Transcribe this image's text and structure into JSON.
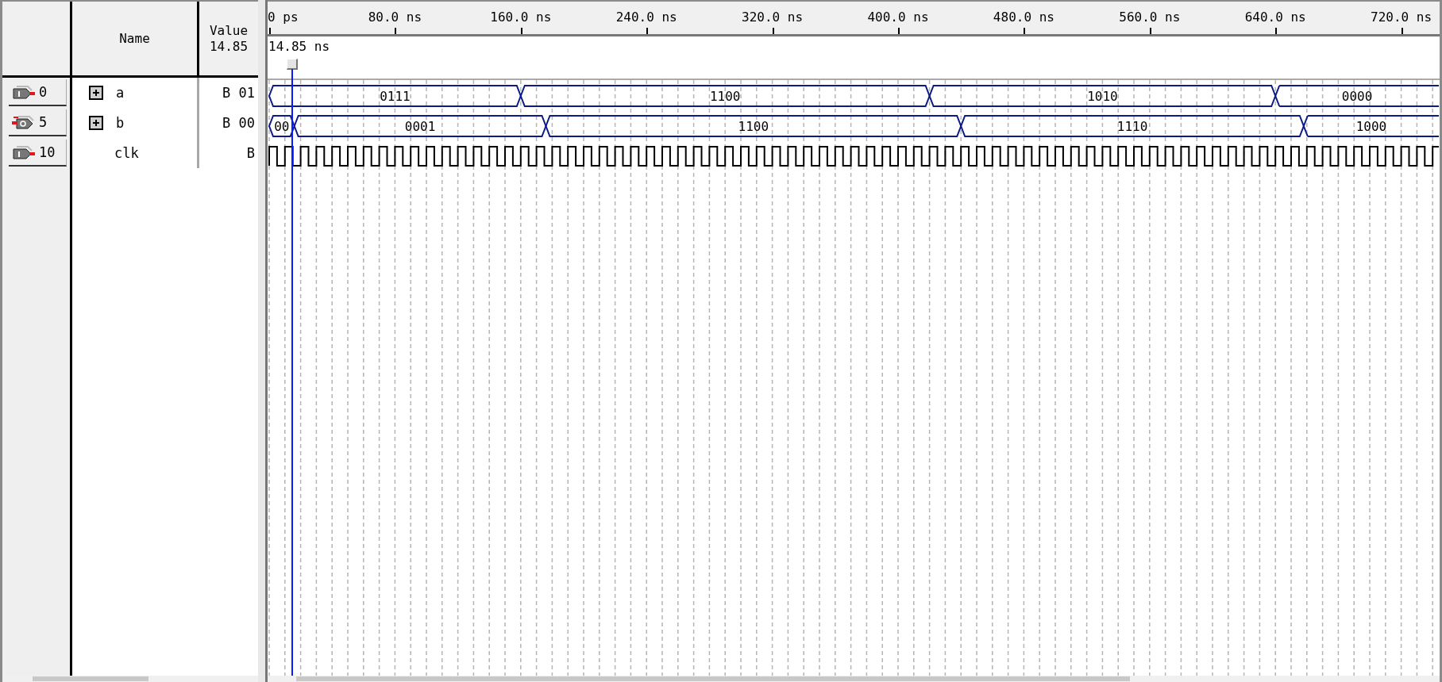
{
  "header": {
    "name": "Name",
    "value": "Value",
    "value_time": "14.85"
  },
  "ruler": {
    "ticks": [
      "0 ps",
      "80.0 ns",
      "160.0 ns",
      "240.0 ns",
      "320.0 ns",
      "400.0 ns",
      "480.0 ns",
      "560.0 ns",
      "640.0 ns",
      "720.0 ns"
    ]
  },
  "cursor": {
    "time": "14.85 ns"
  },
  "signals": [
    {
      "index": "0",
      "pin": {
        "kind": "input"
      },
      "name": "a",
      "expandable": true,
      "value": "B 01",
      "wave": {
        "kind": "bus",
        "segments": [
          "0111",
          "1100",
          "1010",
          "0000"
        ]
      }
    },
    {
      "index": "5",
      "pin": {
        "kind": "output"
      },
      "name": "b",
      "expandable": true,
      "value": "B 00",
      "wave": {
        "kind": "bus",
        "segments": [
          "00",
          "0001",
          "1100",
          "1110",
          "1000"
        ]
      }
    },
    {
      "index": "10",
      "pin": {
        "kind": "input"
      },
      "name": "clk",
      "expandable": false,
      "value": "B",
      "wave": {
        "kind": "clock"
      }
    }
  ]
}
